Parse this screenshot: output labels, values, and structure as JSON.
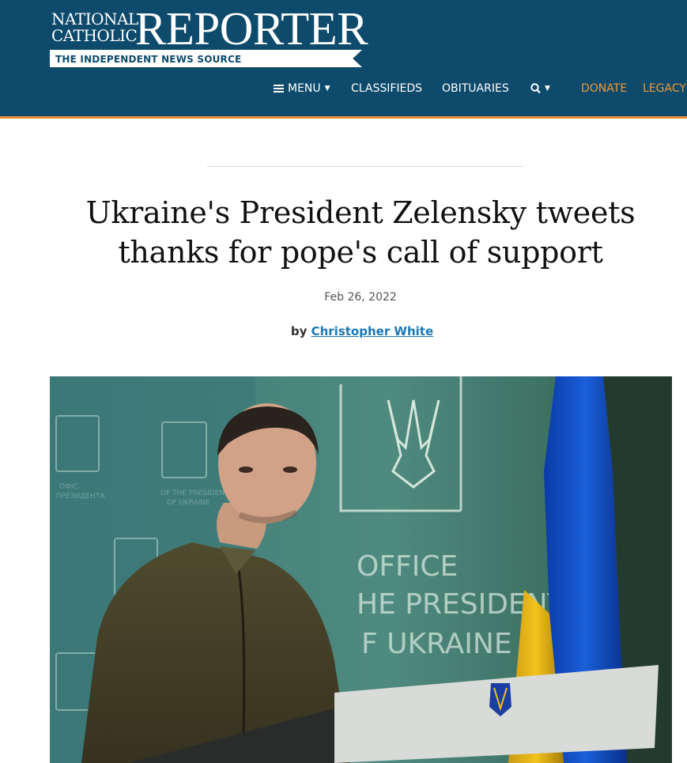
{
  "header": {
    "logo_line1": "NATIONAL",
    "logo_line2": "CATHOLIC",
    "logo_big": "REPORTER",
    "tagline": "THE INDEPENDENT NEWS SOURCE",
    "nav": {
      "menu": "MENU",
      "classifieds": "CLASSIFIEDS",
      "obituaries": "OBITUARIES",
      "donate": "DONATE",
      "legacy": "LEGACY C"
    },
    "icons": [
      "hamburger-icon",
      "caret-down-icon",
      "search-icon"
    ]
  },
  "article": {
    "headline": "Ukraine's President Zelensky tweets thanks for pope's call of support",
    "date": "Feb 26, 2022",
    "by": "by",
    "author": "Christopher White"
  },
  "photo": {
    "backdrop_line1": "OFFICE",
    "backdrop_line2": "HE PRESIDENT",
    "backdrop_line3": "F UKRAINE"
  },
  "colors": {
    "header_bg": "#0d4a6b",
    "accent_orange": "#f19a38",
    "link_blue": "#1a78b4"
  }
}
